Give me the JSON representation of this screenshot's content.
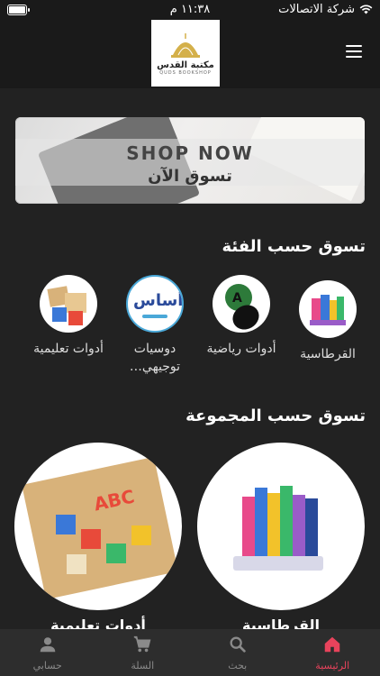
{
  "status": {
    "carrier": "شركة الاتصالات",
    "time": "١١:٣٨ م",
    "battery_level": 0.9
  },
  "header": {
    "logo_title": "مكتبة القدس",
    "logo_subtitle": "QUDS BOOKSHOP"
  },
  "banner": {
    "title_en": "SHOP NOW",
    "title_ar": "تسوق الآن"
  },
  "categories": {
    "title": "تسوق حسب الفئة",
    "items": [
      {
        "label": "القرطاسية",
        "icon": "stationery-image"
      },
      {
        "label": "أدوات رياضية",
        "icon": "ping-pong-image"
      },
      {
        "label": "دوسيات توجيهي…",
        "icon": "asas-logo-image"
      },
      {
        "label": "أدوات تعليمية",
        "icon": "educational-toys-image"
      }
    ]
  },
  "groups": {
    "title": "تسوق حسب المجموعة",
    "items": [
      {
        "label": "القرطاسية",
        "icon": "stationery-image"
      },
      {
        "label": "أدوات تعليمية",
        "icon": "abc-blocks-image"
      }
    ]
  },
  "nav": {
    "items": [
      {
        "label": "الرئيسية",
        "icon": "home-icon",
        "active": true
      },
      {
        "label": "بحث",
        "icon": "search-icon",
        "active": false
      },
      {
        "label": "السلة",
        "icon": "cart-icon",
        "active": false
      },
      {
        "label": "حسابي",
        "icon": "account-icon",
        "active": false
      }
    ],
    "active_color": "#e8435c",
    "inactive_color": "#8a8a8a"
  }
}
